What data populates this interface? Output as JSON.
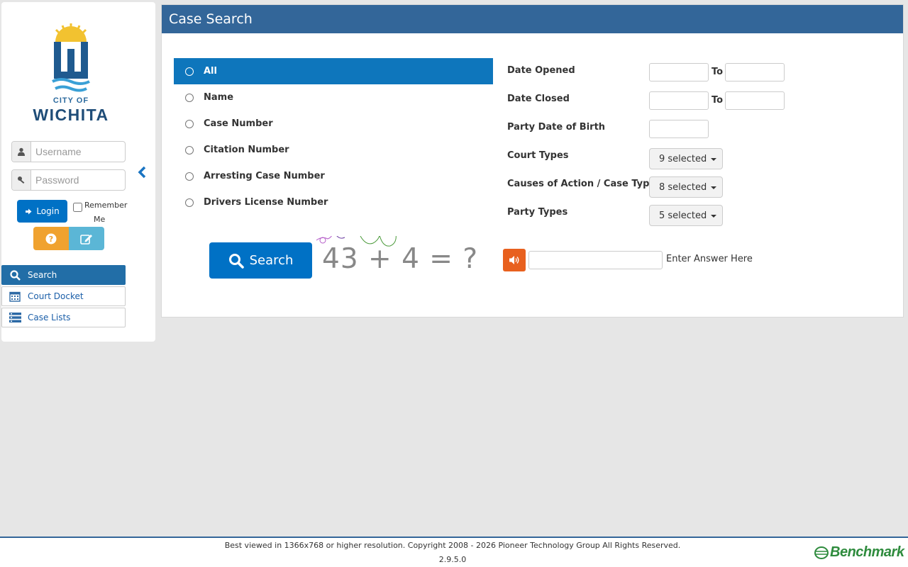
{
  "sidebar": {
    "logo": {
      "line1": "CITY OF",
      "line2": "WICHITA"
    },
    "username_placeholder": "Username",
    "password_placeholder": "Password",
    "login_label": "Login",
    "remember_line1": "Remember",
    "remember_line2": "Me",
    "nav": [
      {
        "label": "Search",
        "icon": "search-icon",
        "active": true
      },
      {
        "label": "Court Docket",
        "icon": "calendar-icon",
        "active": false
      },
      {
        "label": "Case Lists",
        "icon": "list-icon",
        "active": false
      }
    ]
  },
  "main": {
    "title": "Case Search",
    "search_types": [
      {
        "label": "All",
        "selected": true
      },
      {
        "label": "Name",
        "selected": false
      },
      {
        "label": "Case Number",
        "selected": false
      },
      {
        "label": "Citation Number",
        "selected": false
      },
      {
        "label": "Arresting Case Number",
        "selected": false
      },
      {
        "label": "Drivers License Number",
        "selected": false
      }
    ],
    "filters": {
      "date_opened": "Date Opened",
      "date_closed": "Date Closed",
      "party_dob": "Party Date of Birth",
      "court_types": "Court Types",
      "causes": "Causes of Action / Case Types",
      "party_types": "Party Types",
      "to": "To",
      "court_types_value": "9 selected",
      "causes_value": "8 selected",
      "party_types_value": "5 selected"
    },
    "search_label": "Search",
    "captcha_text": "43 + 4 = ?",
    "answer_label": "Enter Answer Here"
  },
  "footer": {
    "copyright": "Best viewed in 1366x768 or higher resolution. Copyright 2008 - 2026 Pioneer Technology Group All Rights Reserved.",
    "version": "2.9.5.0",
    "brand": "Benchmark"
  },
  "colors": {
    "header": "#336699",
    "primary": "#0071c5",
    "help": "#f0a22f",
    "edit": "#5bb6d6",
    "audio": "#e8601e",
    "brand_green": "#2e8b3d"
  }
}
